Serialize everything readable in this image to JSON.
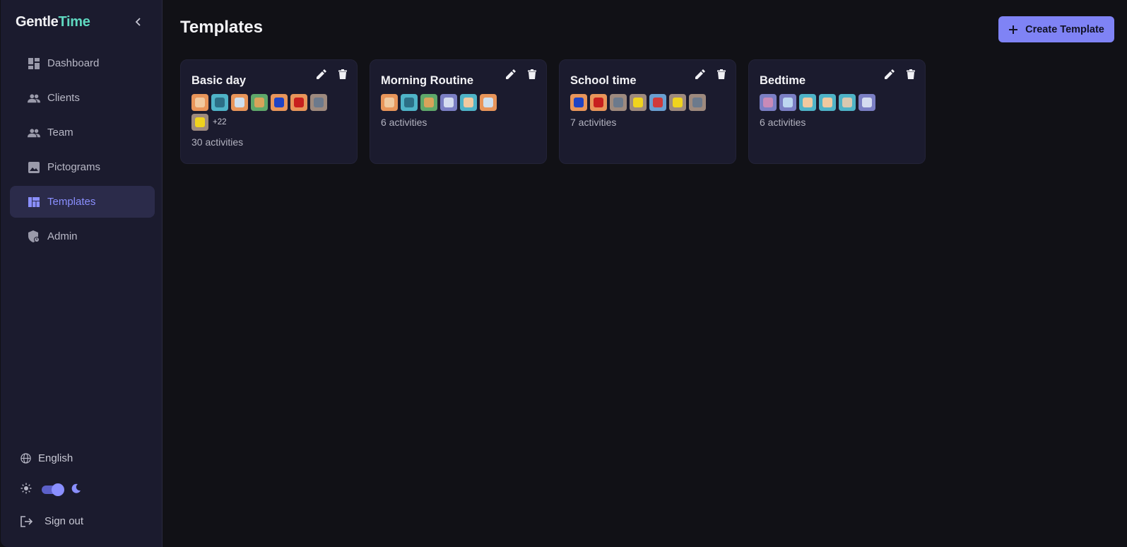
{
  "brand": {
    "part1": "Gentle",
    "part2": "Time"
  },
  "sidebar": {
    "items": [
      {
        "label": "Dashboard",
        "icon": "dashboard-icon"
      },
      {
        "label": "Clients",
        "icon": "people-icon"
      },
      {
        "label": "Team",
        "icon": "people-icon"
      },
      {
        "label": "Pictograms",
        "icon": "image-icon"
      },
      {
        "label": "Templates",
        "icon": "templates-icon",
        "active": true
      },
      {
        "label": "Admin",
        "icon": "shield-icon"
      }
    ],
    "language": "English",
    "theme": "dark",
    "sign_out": "Sign out"
  },
  "main": {
    "title": "Templates",
    "create_label": "Create Template"
  },
  "templates": [
    {
      "title": "Basic day",
      "pictograms": [
        {
          "bg": "#e8955a",
          "fg": "#f0c9a0"
        },
        {
          "bg": "#4fb3c7",
          "fg": "#2c6f86"
        },
        {
          "bg": "#e8955a",
          "fg": "#cfe0ef"
        },
        {
          "bg": "#5fa86a",
          "fg": "#d9a35a"
        },
        {
          "bg": "#e8955a",
          "fg": "#1f43c4"
        },
        {
          "bg": "#e8955a",
          "fg": "#c8201e"
        },
        {
          "bg": "#9e8a7e",
          "fg": "#6c7a8c"
        },
        {
          "bg": "#9e8a7e",
          "fg": "#f0d31e"
        }
      ],
      "more": "+22",
      "count": "30 activities"
    },
    {
      "title": "Morning Routine",
      "pictograms": [
        {
          "bg": "#e8955a",
          "fg": "#f0c9a0"
        },
        {
          "bg": "#4fb3c7",
          "fg": "#2c6f86"
        },
        {
          "bg": "#5fa86a",
          "fg": "#d9a35a"
        },
        {
          "bg": "#7b7fc4",
          "fg": "#d4dcf0"
        },
        {
          "bg": "#4fb3c7",
          "fg": "#f0c9a0"
        },
        {
          "bg": "#e8955a",
          "fg": "#cfe0ef"
        }
      ],
      "more": "",
      "count": "6 activities"
    },
    {
      "title": "School time",
      "pictograms": [
        {
          "bg": "#e8955a",
          "fg": "#1f43c4"
        },
        {
          "bg": "#e8955a",
          "fg": "#c8201e"
        },
        {
          "bg": "#9e8a7e",
          "fg": "#6c7a8c"
        },
        {
          "bg": "#9e8a7e",
          "fg": "#f0d31e"
        },
        {
          "bg": "#6a9fd0",
          "fg": "#d03a3a"
        },
        {
          "bg": "#9e8a7e",
          "fg": "#f0d31e"
        },
        {
          "bg": "#9e8a7e",
          "fg": "#6c7a8c"
        }
      ],
      "more": "",
      "count": "7 activities"
    },
    {
      "title": "Bedtime",
      "pictograms": [
        {
          "bg": "#7b7fc4",
          "fg": "#c88ab8"
        },
        {
          "bg": "#7b7fc4",
          "fg": "#bcd6f0"
        },
        {
          "bg": "#4fb3c7",
          "fg": "#f0c9a0"
        },
        {
          "bg": "#4fb3c7",
          "fg": "#f0c9a0"
        },
        {
          "bg": "#4fb3c7",
          "fg": "#d9c8b0"
        },
        {
          "bg": "#7b7fc4",
          "fg": "#d4dcf0"
        }
      ],
      "more": "",
      "count": "6 activities"
    }
  ],
  "colors": {
    "accent": "#7f83f5",
    "brand_teal": "#5fd8c0",
    "background": "#111116",
    "surface": "#1b1b2e"
  }
}
